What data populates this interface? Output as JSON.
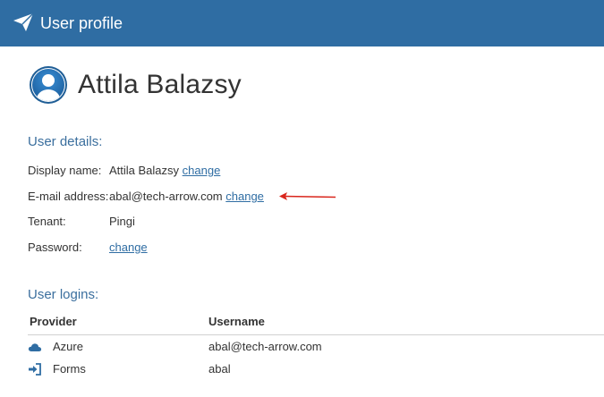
{
  "header": {
    "title": "User profile",
    "logo_icon": "paper-plane-icon",
    "background": "#2f6da3"
  },
  "profile": {
    "name": "Attila Balazsy",
    "avatar_icon": "user-avatar-icon"
  },
  "user_details": {
    "title": "User details:",
    "display_name": {
      "label": "Display name:",
      "value": "Attila Balazsy",
      "link": "change"
    },
    "email": {
      "label": "E-mail address:",
      "value": "abal@tech-arrow.com",
      "link": "change"
    },
    "tenant": {
      "label": "Tenant:",
      "value": "Pingi"
    },
    "password": {
      "label": "Password:",
      "link": "change"
    }
  },
  "annotation": {
    "arrow_color": "#d9261c",
    "points_to": "email-change-link"
  },
  "user_logins": {
    "title": "User logins:",
    "columns": [
      "Provider",
      "Username"
    ],
    "rows": [
      {
        "provider": "Azure",
        "username": "abal@tech-arrow.com",
        "icon": "cloud-icon"
      },
      {
        "provider": "Forms",
        "username": "abal",
        "icon": "sign-in-icon"
      }
    ]
  },
  "colors": {
    "accent": "#2f6da3",
    "section_title": "#3b6f9e"
  }
}
